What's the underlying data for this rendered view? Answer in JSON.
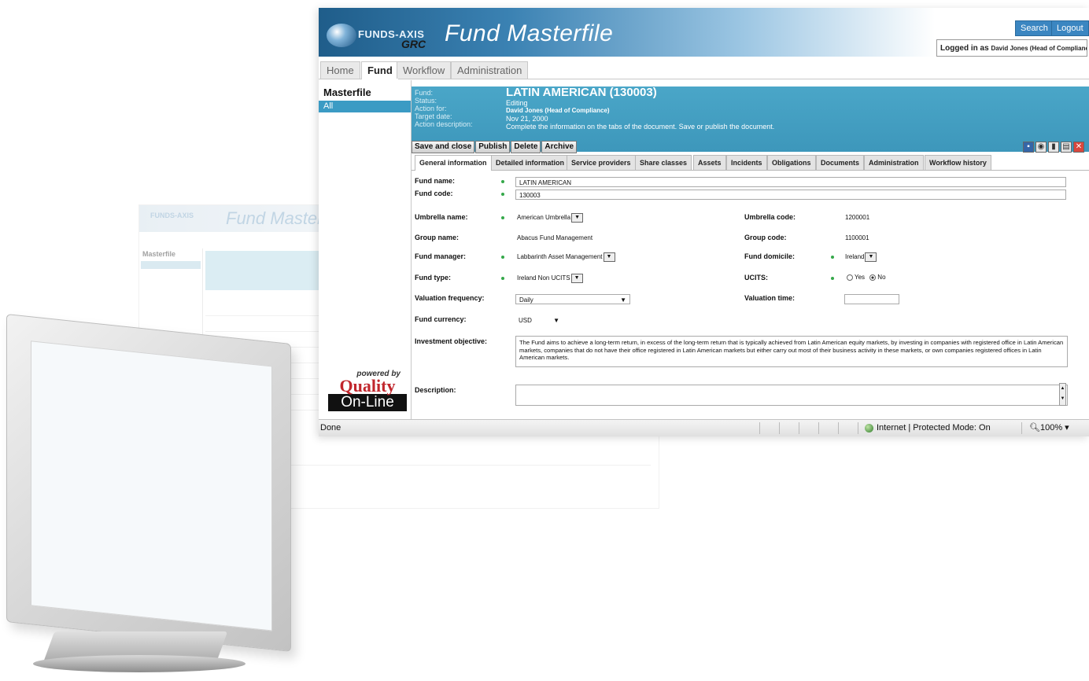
{
  "app": {
    "logo_text": "FUNDS-AXIS",
    "logo_sub": "GRC",
    "title": "Fund Masterfile",
    "search_label": "Search",
    "logout_label": "Logout",
    "logged_in_prefix": "Logged in as",
    "logged_in_user": "David Jones (Head of Compliance)"
  },
  "nav": {
    "tabs": [
      "Home",
      "Fund",
      "Workflow",
      "Administration"
    ],
    "active": "Fund"
  },
  "sidebar": {
    "title": "Masterfile",
    "items": [
      "All"
    ],
    "powered_by": "powered by",
    "brand_top": "Quality",
    "brand_bottom": "On-Line"
  },
  "record": {
    "labels": [
      "Fund:",
      "Status:",
      "Action for:",
      "Target date:",
      "Action description:"
    ],
    "fund_title": "LATIN AMERICAN (130003)",
    "status": "Editing",
    "action_for": "David Jones (Head of Compliance)",
    "target_date": "Nov 21, 2000",
    "action_description": "Complete the information on the tabs of the document. Save or publish the document.",
    "buttons": [
      "Save and close",
      "Publish",
      "Delete",
      "Archive"
    ],
    "tool_icons": [
      "save-icon",
      "workflow-icon",
      "delete-icon",
      "export-icon",
      "close-icon"
    ]
  },
  "doc_tabs": [
    "General information",
    "Detailed information",
    "Service providers",
    "Share classes",
    "Assets",
    "Incidents",
    "Obligations",
    "Documents",
    "Administration",
    "Workflow history"
  ],
  "form": {
    "fund_name_label": "Fund name:",
    "fund_name": "LATIN AMERICAN",
    "fund_code_label": "Fund code:",
    "fund_code": "130003",
    "umbrella_name_label": "Umbrella name:",
    "umbrella_name": "American Umbrella",
    "umbrella_code_label": "Umbrella code:",
    "umbrella_code": "1200001",
    "group_name_label": "Group name:",
    "group_name": "Abacus Fund Management",
    "group_code_label": "Group code:",
    "group_code": "1100001",
    "fund_manager_label": "Fund manager:",
    "fund_manager": "Labbarinth Asset Management",
    "fund_domicile_label": "Fund domicile:",
    "fund_domicile": "Ireland",
    "fund_type_label": "Fund type:",
    "fund_type": "Ireland Non UCITS",
    "ucits_label": "UCITS:",
    "ucits_yes": "Yes",
    "ucits_no": "No",
    "ucits_value": "No",
    "valuation_frequency_label": "Valuation frequency:",
    "valuation_frequency": "Daily",
    "valuation_time_label": "Valuation time:",
    "valuation_time": "",
    "fund_currency_label": "Fund currency:",
    "fund_currency": "USD",
    "investment_objective_label": "Investment objective:",
    "investment_objective": "The Fund aims to achieve a long-term return, in excess of the long-term return that is typically achieved from Latin American equity markets, by investing in companies with registered office in Latin American markets, companies that do not have their office registered in Latin American markets but either carry out most of their business activity in these markets, or own companies registered offices in Latin American markets.",
    "description_label": "Description:",
    "description": ""
  },
  "statusbar": {
    "left": "Done",
    "zone": "Internet | Protected Mode: On",
    "zoom": "100%"
  },
  "colors": {
    "accent": "#3d97bb",
    "header_dark": "#1f5d8a",
    "brand_red": "#c1272d",
    "required_dot": "#35a84a"
  }
}
